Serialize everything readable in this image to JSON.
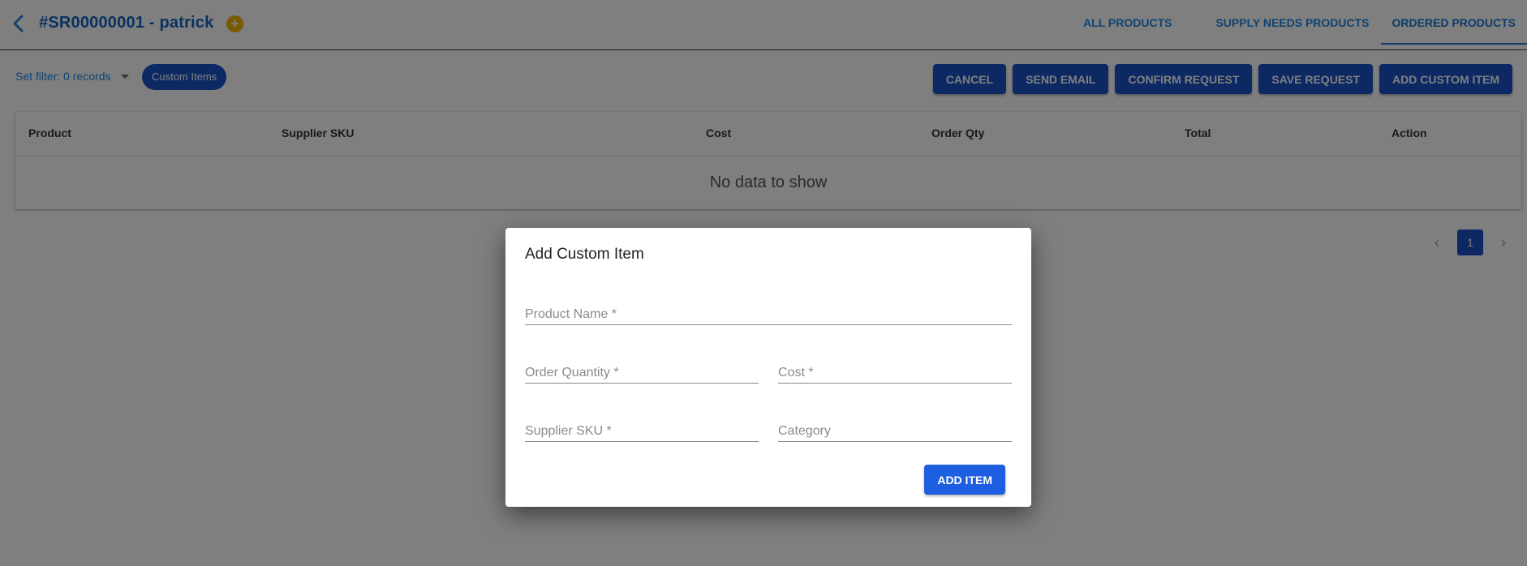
{
  "header": {
    "title": "#SR00000001 - patrick",
    "back_icon": "chevron-left-icon",
    "add_icon": "plus-circle-icon",
    "add_symbol": "+"
  },
  "tabs": [
    {
      "label": "ALL PRODUCTS",
      "active": false
    },
    {
      "label": "SUPPLY NEEDS PRODUCTS",
      "active": false
    },
    {
      "label": "ORDERED PRODUCTS",
      "active": true
    }
  ],
  "toolbar": {
    "filter_label": "Set filter: 0 records",
    "chip_label": "Custom Items",
    "buttons": [
      "CANCEL",
      "SEND EMAIL",
      "CONFIRM REQUEST",
      "SAVE REQUEST",
      "ADD CUSTOM ITEM"
    ]
  },
  "table": {
    "columns": [
      "Product",
      "Supplier SKU",
      "Cost",
      "Order Qty",
      "Total",
      "Action"
    ],
    "empty_text": "No data to show"
  },
  "pagination": {
    "prev": "‹",
    "current_page": "1",
    "next": "›"
  },
  "dialog": {
    "title": "Add Custom Item",
    "fields": {
      "product_name": {
        "placeholder": "Product Name *",
        "value": ""
      },
      "order_quantity": {
        "placeholder": "Order Quantity *",
        "value": ""
      },
      "cost": {
        "placeholder": "Cost *",
        "value": ""
      },
      "supplier_sku": {
        "placeholder": "Supplier SKU *",
        "value": ""
      },
      "category": {
        "placeholder": "Category",
        "value": ""
      }
    },
    "submit_label": "ADD ITEM"
  },
  "colors": {
    "primary": "#1a53c8",
    "link": "#1e88e5",
    "accent_add": "#f4b400",
    "overlay": "rgba(0,0,0,0.5)"
  }
}
